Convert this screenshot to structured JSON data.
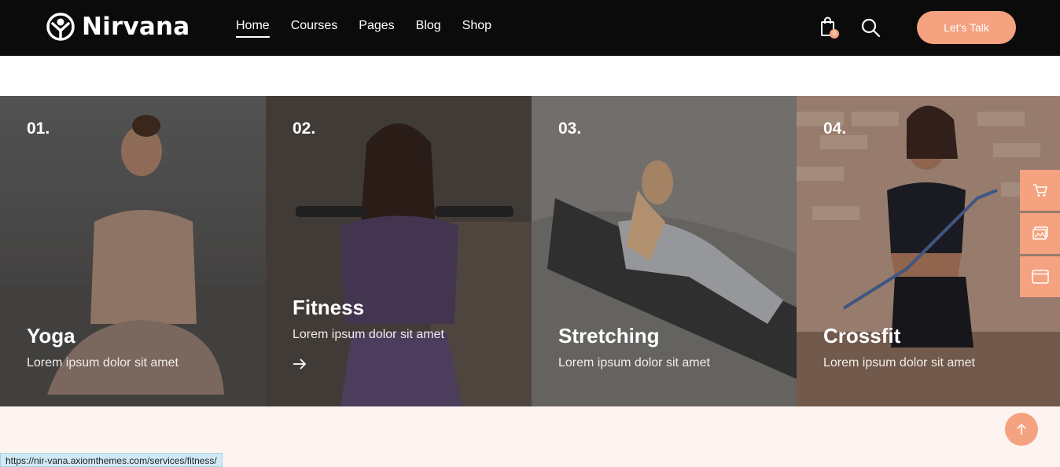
{
  "header": {
    "logo_text": "Nirvana",
    "nav": [
      {
        "label": "Home",
        "active": true
      },
      {
        "label": "Courses",
        "active": false
      },
      {
        "label": "Pages",
        "active": false
      },
      {
        "label": "Blog",
        "active": false
      },
      {
        "label": "Shop",
        "active": false
      }
    ],
    "cart_count": "0",
    "cta_label": "Let’s Talk"
  },
  "services": [
    {
      "number": "01.",
      "title": "Yoga",
      "description": "Lorem ipsum dolor sit amet"
    },
    {
      "number": "02.",
      "title": "Fitness",
      "description": "Lorem ipsum dolor sit amet"
    },
    {
      "number": "03.",
      "title": "Stretching",
      "description": "Lorem ipsum dolor sit amet"
    },
    {
      "number": "04.",
      "title": "Crossfit",
      "description": "Lorem ipsum dolor sit amet"
    }
  ],
  "side_icons": [
    "cart-icon",
    "image-icon",
    "browser-window-icon"
  ],
  "status_url": "https://nir-vana.axiomthemes.com/services/fitness/",
  "colors": {
    "accent": "#f4a27f",
    "header_bg": "#0b0b0b",
    "section_bg": "#fdf3f0"
  }
}
